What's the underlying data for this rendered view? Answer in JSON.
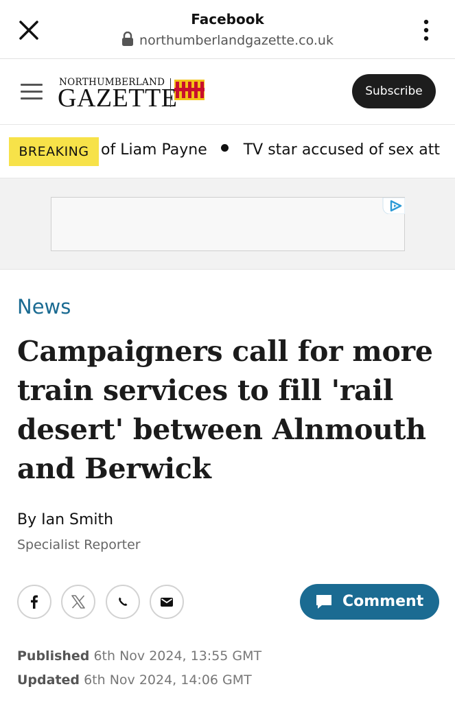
{
  "browser": {
    "title": "Facebook",
    "url": "northumberlandgazette.co.uk"
  },
  "header": {
    "logo_top": "NORTHUMBERLAND",
    "logo_main": "GAZETTE",
    "subscribe_label": "Subscribe"
  },
  "ticker": {
    "badge": "BREAKING",
    "items": [
      "of Liam Payne",
      "TV star accused of sex att"
    ]
  },
  "article": {
    "section": "News",
    "headline": "Campaigners call for more train services to fill 'rail desert' between Alnmouth and Berwick",
    "byline": "By Ian Smith",
    "role": "Specialist Reporter",
    "comment_label": "Comment",
    "published_label": "Published",
    "published_value": "6th Nov 2024, 13:55 GMT",
    "updated_label": "Updated",
    "updated_value": "6th Nov 2024, 14:06 GMT"
  },
  "share": {
    "icons": [
      "facebook-icon",
      "x-icon",
      "whatsapp-icon",
      "email-icon"
    ]
  },
  "colors": {
    "accent": "#1b6b92",
    "breaking_badge": "#f7e249",
    "subscribe_bg": "#1d1d1d"
  }
}
